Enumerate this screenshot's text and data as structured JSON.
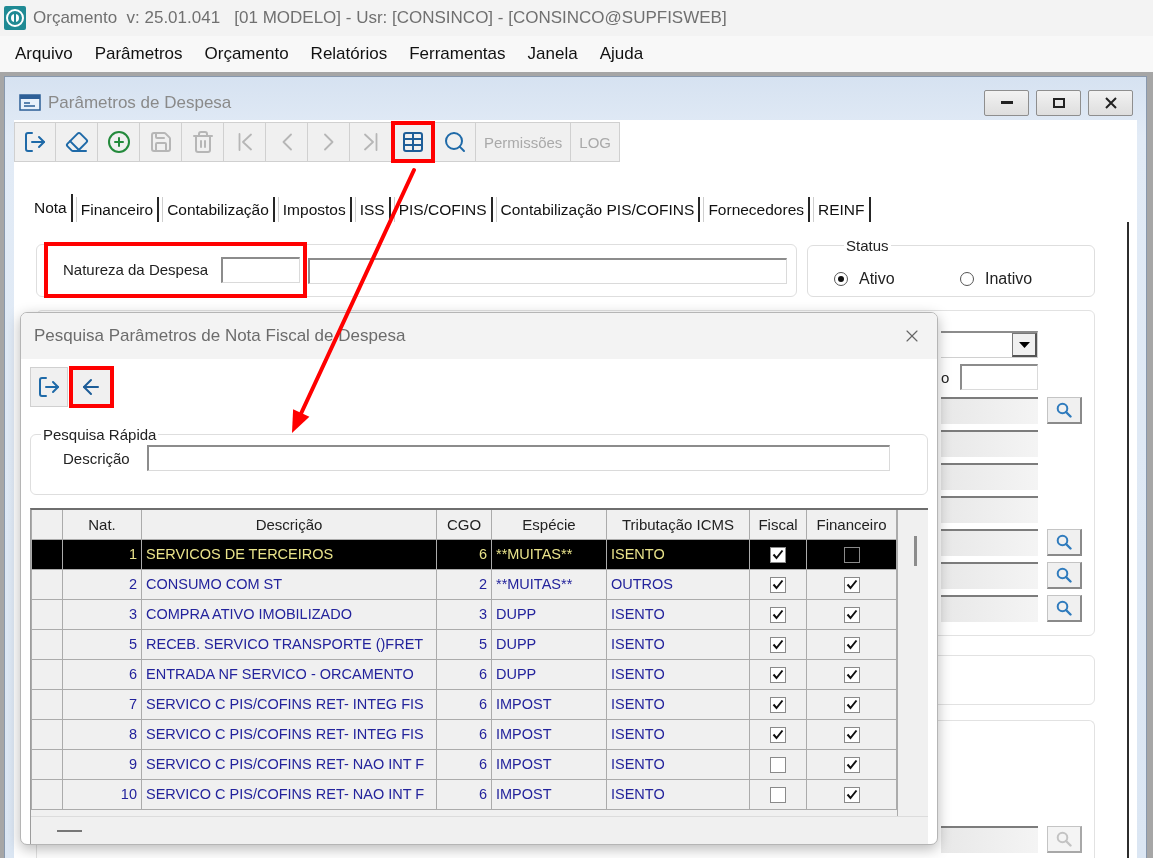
{
  "app_title_bar": {
    "title": "Orçamento  v: 25.01.041   [01 MODELO] - Usr: [CONSINCO] - [CONSINCO@SUPFISWEB]"
  },
  "menu_bar": [
    "Arquivo",
    "Parâmetros",
    "Orçamento",
    "Relatórios",
    "Ferramentas",
    "Janela",
    "Ajuda"
  ],
  "form_window": {
    "title": "Parâmetros de Despesa",
    "toolbar": [
      {
        "kind": "exit",
        "disabled": false,
        "highlighted": false
      },
      {
        "kind": "erase",
        "disabled": false,
        "highlighted": false
      },
      {
        "kind": "add",
        "disabled": false,
        "highlighted": false
      },
      {
        "kind": "save",
        "disabled": true,
        "highlighted": false
      },
      {
        "kind": "delete",
        "disabled": true,
        "highlighted": false
      },
      {
        "kind": "first",
        "disabled": true,
        "highlighted": false
      },
      {
        "kind": "previous",
        "disabled": true,
        "highlighted": false
      },
      {
        "kind": "next",
        "disabled": true,
        "highlighted": false
      },
      {
        "kind": "last",
        "disabled": true,
        "highlighted": false
      },
      {
        "kind": "grid",
        "disabled": false,
        "highlighted": true
      },
      {
        "kind": "search",
        "disabled": false,
        "highlighted": false
      },
      {
        "kind": "text",
        "label": "Permissões",
        "disabled": true,
        "highlighted": false
      },
      {
        "kind": "text",
        "label": "LOG",
        "disabled": true,
        "highlighted": false
      }
    ],
    "tabs": [
      {
        "label": "Nota",
        "selected": true
      },
      {
        "label": "Financeiro",
        "selected": false
      },
      {
        "label": "Contabilização",
        "selected": false
      },
      {
        "label": "Impostos",
        "selected": false
      },
      {
        "label": "ISS",
        "selected": false
      },
      {
        "label": "PIS/COFINS",
        "selected": false
      },
      {
        "label": "Contabilização PIS/COFINS",
        "selected": false
      },
      {
        "label": "Fornecedores",
        "selected": false
      },
      {
        "label": "REINF",
        "selected": false
      }
    ],
    "natureza": {
      "label": "Natureza da Despesa",
      "highlighted": true
    },
    "status": {
      "title": "Status",
      "options": [
        {
          "label": "Ativo",
          "selected": true
        },
        {
          "label": "Inativo",
          "selected": false
        }
      ]
    },
    "detail_fields": [
      {
        "kind": "dropdown"
      },
      {
        "kind": "input",
        "label": "o"
      },
      {
        "kind": "readonly",
        "lookup": true,
        "lookup_disabled": false
      },
      {
        "kind": "readonly",
        "lookup": false
      },
      {
        "kind": "readonly",
        "lookup": false
      },
      {
        "kind": "readonly",
        "lookup": false
      },
      {
        "kind": "readonly",
        "lookup": true,
        "lookup_disabled": false
      },
      {
        "kind": "readonly",
        "lookup": true,
        "lookup_disabled": false
      },
      {
        "kind": "readonly",
        "lookup": true,
        "lookup_disabled": false
      }
    ],
    "lower_fields": [
      {
        "kind": "readonly",
        "lookup": true,
        "lookup_disabled": true
      }
    ]
  },
  "search_dialog": {
    "title": "Pesquisa Parâmetros de Nota Fiscal de Despesa",
    "toolbar": [
      {
        "kind": "exit",
        "highlighted": false
      },
      {
        "kind": "back",
        "highlighted": true
      }
    ],
    "quick_search": {
      "title": "Pesquisa Rápida",
      "label": "Descrição"
    },
    "grid": {
      "columns": [
        "Nat.",
        "Descrição",
        "CGO",
        "Espécie",
        "Tributação ICMS",
        "Fiscal",
        "Financeiro"
      ],
      "rows": [
        {
          "nat": "1",
          "descricao": "SERVICOS DE TERCEIROS",
          "cgo": "6",
          "especie": "**MUITAS**",
          "tributacao_icms": "ISENTO",
          "fiscal": true,
          "financeiro": false,
          "selected": true
        },
        {
          "nat": "2",
          "descricao": "CONSUMO COM ST",
          "cgo": "2",
          "especie": "**MUITAS**",
          "tributacao_icms": "OUTROS",
          "fiscal": true,
          "financeiro": true,
          "selected": false
        },
        {
          "nat": "3",
          "descricao": "COMPRA ATIVO IMOBILIZADO",
          "cgo": "3",
          "especie": "DUPP",
          "tributacao_icms": "ISENTO",
          "fiscal": true,
          "financeiro": true,
          "selected": false
        },
        {
          "nat": "5",
          "descricao": "RECEB. SERVICO TRANSPORTE ()FRET",
          "cgo": "5",
          "especie": "DUPP",
          "tributacao_icms": "ISENTO",
          "fiscal": true,
          "financeiro": true,
          "selected": false
        },
        {
          "nat": "6",
          "descricao": "ENTRADA NF SERVICO - ORCAMENTO",
          "cgo": "6",
          "especie": "DUPP",
          "tributacao_icms": "ISENTO",
          "fiscal": true,
          "financeiro": true,
          "selected": false
        },
        {
          "nat": "7",
          "descricao": "SERVICO C PIS/COFINS RET- INTEG FIS",
          "cgo": "6",
          "especie": "IMPOST",
          "tributacao_icms": "ISENTO",
          "fiscal": true,
          "financeiro": true,
          "selected": false
        },
        {
          "nat": "8",
          "descricao": "SERVICO C PIS/COFINS RET- INTEG FIS",
          "cgo": "6",
          "especie": "IMPOST",
          "tributacao_icms": "ISENTO",
          "fiscal": true,
          "financeiro": true,
          "selected": false
        },
        {
          "nat": "9",
          "descricao": "SERVICO C PIS/COFINS RET- NAO INT F",
          "cgo": "6",
          "especie": "IMPOST",
          "tributacao_icms": "ISENTO",
          "fiscal": false,
          "financeiro": true,
          "selected": false
        },
        {
          "nat": "10",
          "descricao": "SERVICO C PIS/COFINS RET- NAO INT F",
          "cgo": "6",
          "especie": "IMPOST",
          "tributacao_icms": "ISENTO",
          "fiscal": false,
          "financeiro": true,
          "selected": false
        }
      ]
    }
  }
}
